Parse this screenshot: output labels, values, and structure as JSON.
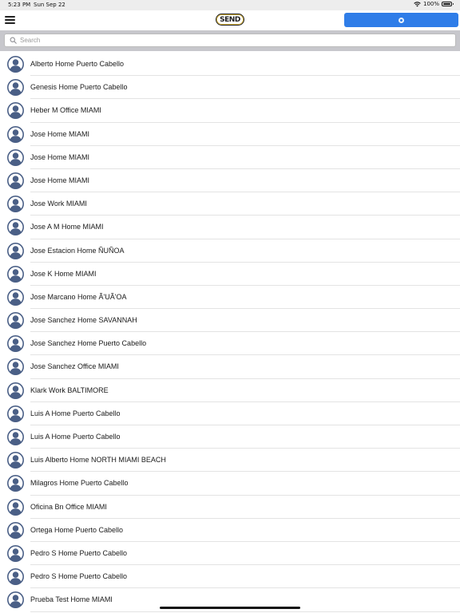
{
  "status_bar": {
    "time": "5:23 PM",
    "date": "Sun Sep 22",
    "battery": "100%"
  },
  "navbar": {
    "logo_text": "SEND",
    "accent_color": "#2f7de8",
    "logo_accent": "#d8b33a"
  },
  "search": {
    "placeholder": "Search",
    "value": ""
  },
  "contacts": [
    {
      "name": "Alberto Home Puerto Cabello"
    },
    {
      "name": "Genesis Home Puerto Cabello"
    },
    {
      "name": "Heber M Office MIAMI"
    },
    {
      "name": "Jose Home MIAMI"
    },
    {
      "name": "Jose Home MIAMI"
    },
    {
      "name": "Jose Home MIAMI"
    },
    {
      "name": "Jose Work MIAMI"
    },
    {
      "name": "Jose A M Home MIAMI"
    },
    {
      "name": "Jose Estacion Home ÑUÑOA"
    },
    {
      "name": "Jose K Home MIAMI"
    },
    {
      "name": "Jose Marcano Home Ã'UÃ'OA"
    },
    {
      "name": "Jose Sanchez Home SAVANNAH"
    },
    {
      "name": "Jose Sanchez Home Puerto Cabello"
    },
    {
      "name": "Jose Sanchez Office MIAMI"
    },
    {
      "name": "Klark Work BALTIMORE"
    },
    {
      "name": "Luis A Home Puerto Cabello"
    },
    {
      "name": "Luis A Home Puerto Cabello"
    },
    {
      "name": "Luis Alberto Home NORTH MIAMI BEACH"
    },
    {
      "name": "Milagros Home Puerto Cabello"
    },
    {
      "name": "Oficina Bn Office MIAMI"
    },
    {
      "name": "Ortega Home Puerto Cabello"
    },
    {
      "name": "Pedro S Home Puerto Cabello"
    },
    {
      "name": "Pedro S Home Puerto Cabello"
    },
    {
      "name": "Prueba Test Home MIAMI"
    }
  ]
}
